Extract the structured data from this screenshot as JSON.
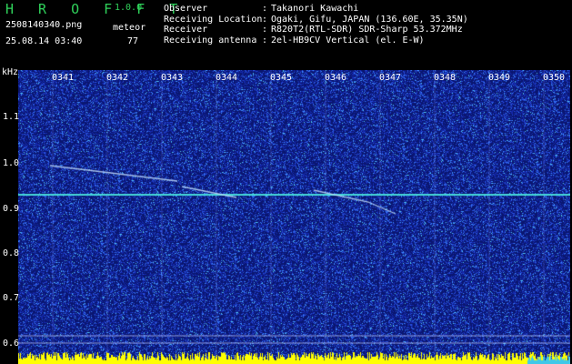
{
  "app": {
    "title": "H R O F F T",
    "version": "1.0.0"
  },
  "file": {
    "name": "2508140340.png",
    "datetime": "25.08.14 03:40"
  },
  "detection": {
    "mode": "meteor",
    "count": "77"
  },
  "info": [
    {
      "key": "Observer",
      "value": "Takanori Kawachi"
    },
    {
      "key": "Receiving Location",
      "value": "Ogaki, Gifu, JAPAN (136.60E, 35.35N)"
    },
    {
      "key": "Receiver",
      "value": "R820T2(RTL-SDR) SDR-Sharp 53.372MHz"
    },
    {
      "key": "Receiving antenna",
      "value": "2el-HB9CV Vertical (el. E-W)"
    }
  ],
  "axis": {
    "y_unit": "kHz",
    "y_ticks": [
      "1.1",
      "1.0",
      "0.9",
      "0.8",
      "0.7",
      "0.6"
    ],
    "x_ticks": [
      "0341",
      "0342",
      "0343",
      "0344",
      "0345",
      "0346",
      "0347",
      "0348",
      "0349",
      "0350"
    ]
  },
  "colors": {
    "title": "#2fd15a",
    "spectrum_bg": "#0a1670",
    "baseline": "#45d8d8",
    "level_bar": "#ffff00"
  }
}
